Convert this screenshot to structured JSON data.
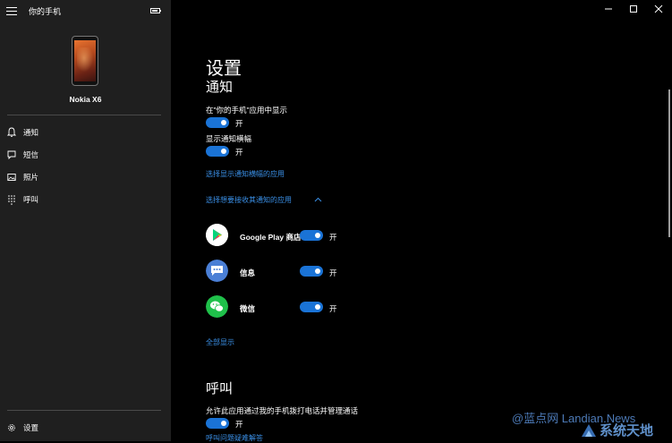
{
  "app": {
    "title": "你的手机"
  },
  "window": {
    "minimize": "—",
    "maximize": "☐",
    "close": "✕"
  },
  "sidebar": {
    "phone_name": "Nokia X6",
    "items": [
      {
        "label": "通知",
        "icon": "bell-icon"
      },
      {
        "label": "短信",
        "icon": "message-icon"
      },
      {
        "label": "照片",
        "icon": "photo-icon"
      },
      {
        "label": "呼叫",
        "icon": "dialpad-icon"
      }
    ],
    "settings_label": "设置"
  },
  "main": {
    "title": "设置",
    "notifications": {
      "heading": "通知",
      "show_in_app": {
        "label": "在\"你的手机\"应用中显示",
        "state": "开",
        "on": true
      },
      "show_banner": {
        "label": "显示通知横幅",
        "state": "开",
        "on": true
      },
      "banner_apps_link": "选择显示通知横幅的应用",
      "choose_apps_link": "选择想要接收其通知的应用",
      "apps": [
        {
          "name": "Google Play 商店",
          "state": "开",
          "on": true,
          "icon": "google-play-icon"
        },
        {
          "name": "信息",
          "state": "开",
          "on": true,
          "icon": "messages-app-icon"
        },
        {
          "name": "微信",
          "state": "开",
          "on": true,
          "icon": "wechat-icon"
        }
      ],
      "show_all_link": "全部显示"
    },
    "calls": {
      "heading": "呼叫",
      "allow": {
        "label": "允许此应用通过我的手机拨打电话并管理通话",
        "state": "开",
        "on": true
      },
      "troubleshoot_link": "呼叫问题疑难解答"
    }
  },
  "watermark": {
    "text": "@蓝点网 Landian.News",
    "cn_text": "系统天地"
  },
  "colors": {
    "accent": "#1a73d6",
    "link": "#3a8fe6",
    "sidebar_bg": "#1f1f1f",
    "main_bg": "#000000"
  }
}
